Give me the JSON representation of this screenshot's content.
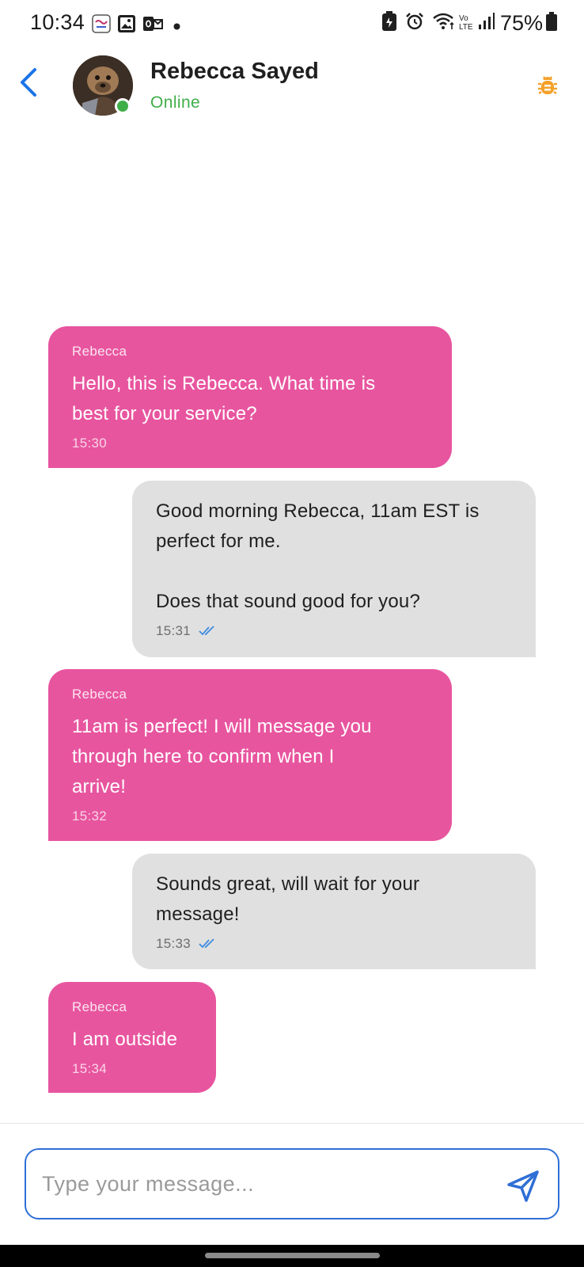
{
  "status_bar": {
    "time": "10:34",
    "battery": "75%",
    "network_label": "Vo LTE",
    "left_icons": [
      "app-notification-icon",
      "image-icon",
      "outlook-icon",
      "dot-icon"
    ],
    "right_icons": [
      "battery-saver-icon",
      "alarm-icon",
      "wifi-icon",
      "signal-icon",
      "battery-icon"
    ]
  },
  "header": {
    "contact_name": "Rebecca Sayed",
    "status": "Online",
    "back_icon": "chevron-left-icon",
    "action_icon": "bug-icon"
  },
  "messages": [
    {
      "direction": "incoming",
      "sender": "Rebecca",
      "lines": [
        "Hello, this is Rebecca. What time is",
        "best for your service?"
      ],
      "time": "15:30"
    },
    {
      "direction": "outgoing",
      "lines": [
        "Good morning Rebecca, 11am EST is",
        "perfect for me.",
        "",
        "Does that sound good for you?"
      ],
      "time": "15:31",
      "read": true
    },
    {
      "direction": "incoming",
      "sender": "Rebecca",
      "lines": [
        "11am is perfect! I will message you",
        "through here to confirm when I",
        "arrive!"
      ],
      "time": "15:32"
    },
    {
      "direction": "outgoing",
      "lines": [
        "Sounds great, will wait for your",
        "message!"
      ],
      "time": "15:33",
      "read": true
    },
    {
      "direction": "incoming",
      "sender": "Rebecca",
      "lines": [
        "I am outside"
      ],
      "time": "15:34"
    }
  ],
  "composer": {
    "placeholder": "Type your message...",
    "value": "",
    "send_icon": "send-icon"
  },
  "colors": {
    "incoming_bubble": "#e8559f",
    "outgoing_bubble": "#e0e0e0",
    "online": "#3fae49",
    "accent": "#2f6fd6",
    "bug_icon": "#f4a12a"
  }
}
